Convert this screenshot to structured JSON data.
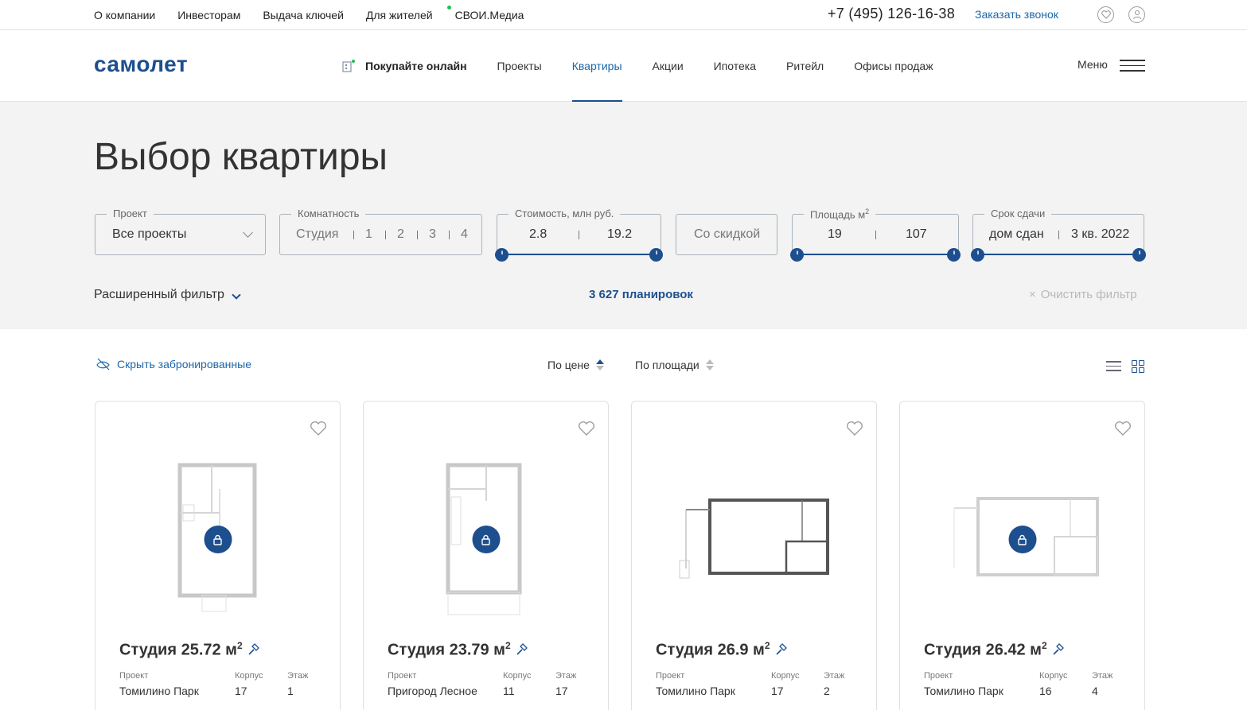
{
  "topbar": {
    "links": [
      "О компании",
      "Инвесторам",
      "Выдача ключей",
      "Для жителей",
      "СВОИ.Медиа"
    ],
    "phone": "+7 (495) 126-16-38",
    "callback": "Заказать звонок",
    "icons": [
      "heart-icon",
      "user-icon"
    ]
  },
  "header": {
    "logo": "самолет",
    "buy_online": "Покупайте онлайн",
    "nav": [
      "Проекты",
      "Квартиры",
      "Акции",
      "Ипотека",
      "Ритейл",
      "Офисы продаж"
    ],
    "active_nav": "Квартиры",
    "menu": "Меню"
  },
  "filters": {
    "title": "Выбор квартиры",
    "project": {
      "label": "Проект",
      "value": "Все проекты"
    },
    "rooms": {
      "label": "Комнатность",
      "options": [
        "Студия",
        "1",
        "2",
        "3",
        "4"
      ]
    },
    "price": {
      "label": "Стоимость, млн руб.",
      "min": "2.8",
      "max": "19.2"
    },
    "discount": "Со скидкой",
    "area": {
      "label": "Площадь м",
      "sup": "2",
      "min": "19",
      "max": "107"
    },
    "deadline": {
      "label": "Срок сдачи",
      "min": "дом сдан",
      "max": "3 кв. 2022"
    },
    "advanced": "Расширенный фильтр",
    "count": "3 627 планировок",
    "clear": "Очистить фильтр"
  },
  "sortbar": {
    "hide_booked": "Скрыть забронированные",
    "sort_price": "По цене",
    "sort_area": "По площади"
  },
  "cards": [
    {
      "title": "Студия 25.72 м",
      "project_label": "Проект",
      "project": "Томилино Парк",
      "building_label": "Корпус",
      "building": "17",
      "floor_label": "Этаж",
      "floor": "1",
      "locked": true
    },
    {
      "title": "Студия 23.79 м",
      "project_label": "Проект",
      "project": "Пригород Лесное",
      "building_label": "Корпус",
      "building": "11",
      "floor_label": "Этаж",
      "floor": "17",
      "locked": true
    },
    {
      "title": "Студия 26.9 м",
      "project_label": "Проект",
      "project": "Томилино Парк",
      "building_label": "Корпус",
      "building": "17",
      "floor_label": "Этаж",
      "floor": "2",
      "locked": false
    },
    {
      "title": "Студия 26.42 м",
      "project_label": "Проект",
      "project": "Томилино Парк",
      "building_label": "Корпус",
      "building": "16",
      "floor_label": "Этаж",
      "floor": "4",
      "locked": true
    }
  ],
  "colors": {
    "brand": "#1d4f8f",
    "link": "#1d66a8",
    "filter_bg": "#f3f3f3",
    "online_dot": "#1fbf56"
  }
}
